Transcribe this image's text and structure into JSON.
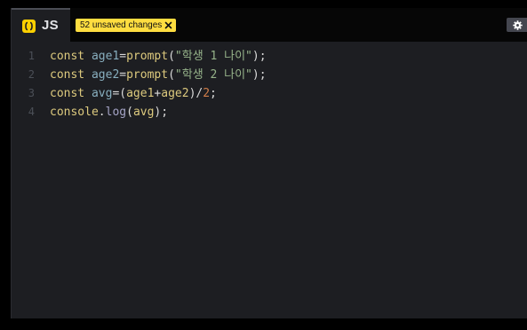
{
  "tab": {
    "label": "JS",
    "icon": "js-braces-icon",
    "icon_color": "#fcd000"
  },
  "unsaved": {
    "label": "52 unsaved changes",
    "close_icon": "close-icon",
    "color": "#ffdd40"
  },
  "settings": {
    "icon": "gear-icon"
  },
  "editor": {
    "line_numbers": [
      "1",
      "2",
      "3",
      "4"
    ],
    "lines": [
      [
        {
          "t": "const",
          "c": "keyword"
        },
        {
          "t": " ",
          "c": "plain"
        },
        {
          "t": "age1",
          "c": "variable"
        },
        {
          "t": "=",
          "c": "operator"
        },
        {
          "t": "prompt",
          "c": "def"
        },
        {
          "t": "(",
          "c": "punct"
        },
        {
          "t": "\"학생 1 나이\"",
          "c": "string"
        },
        {
          "t": ");",
          "c": "punct"
        }
      ],
      [
        {
          "t": "const",
          "c": "keyword"
        },
        {
          "t": " ",
          "c": "plain"
        },
        {
          "t": "age2",
          "c": "variable"
        },
        {
          "t": "=",
          "c": "operator"
        },
        {
          "t": "prompt",
          "c": "def"
        },
        {
          "t": "(",
          "c": "punct"
        },
        {
          "t": "\"학생 2 나이\"",
          "c": "string"
        },
        {
          "t": ");",
          "c": "punct"
        }
      ],
      [
        {
          "t": "const",
          "c": "keyword"
        },
        {
          "t": " ",
          "c": "plain"
        },
        {
          "t": "avg",
          "c": "variable"
        },
        {
          "t": "=(",
          "c": "operator"
        },
        {
          "t": "age1",
          "c": "def"
        },
        {
          "t": "+",
          "c": "operator"
        },
        {
          "t": "age2",
          "c": "def"
        },
        {
          "t": ")/",
          "c": "operator"
        },
        {
          "t": "2",
          "c": "number"
        },
        {
          "t": ";",
          "c": "punct"
        }
      ],
      [
        {
          "t": "console",
          "c": "def"
        },
        {
          "t": ".",
          "c": "punct"
        },
        {
          "t": "log",
          "c": "property"
        },
        {
          "t": "(",
          "c": "punct"
        },
        {
          "t": "avg",
          "c": "def"
        },
        {
          "t": ");",
          "c": "punct"
        }
      ]
    ]
  }
}
